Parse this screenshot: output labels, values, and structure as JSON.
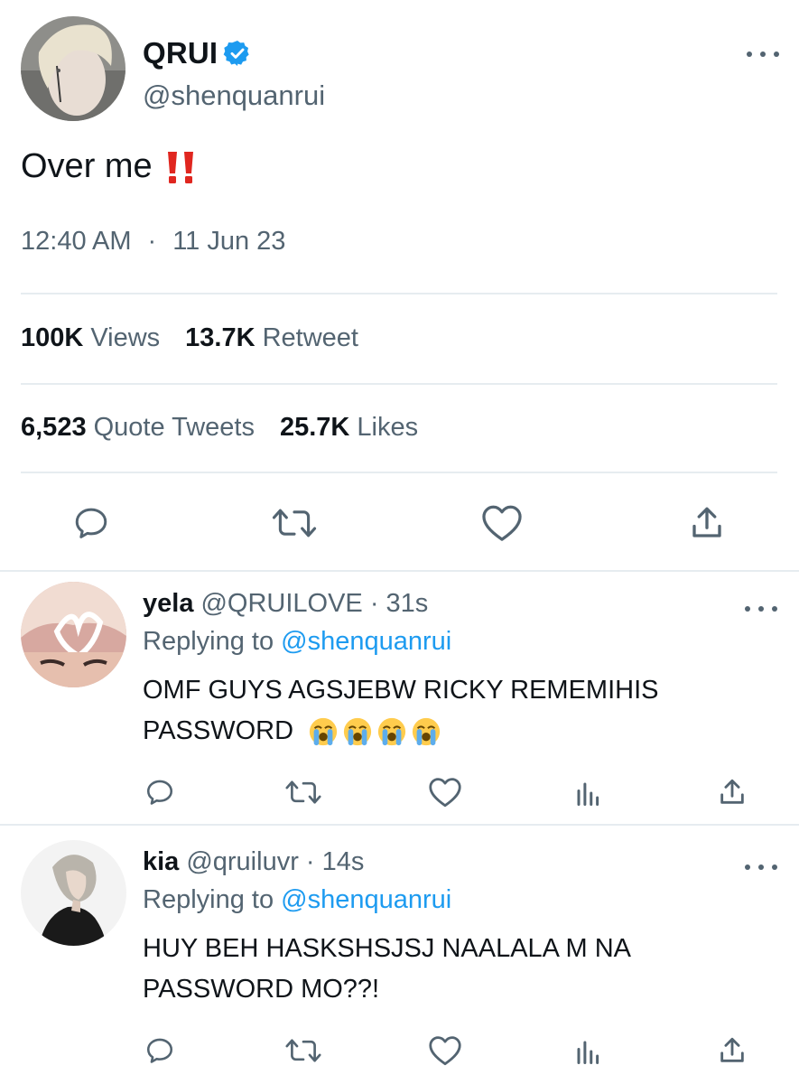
{
  "main_tweet": {
    "display_name": "QRUI",
    "handle": "@shenquanrui",
    "text": "Over me",
    "emoji": "double-exclamation",
    "time": "12:40 AM",
    "separator": "·",
    "date": "11 Jun 23",
    "stats": {
      "views_count": "100K",
      "views_label": "Views",
      "retweets_count": "13.7K",
      "retweets_label": "Retweet",
      "quotes_count": "6,523",
      "quotes_label": "Quote Tweets",
      "likes_count": "25.7K",
      "likes_label": "Likes"
    },
    "actions": [
      "reply-icon",
      "retweet-icon",
      "like-icon",
      "share-icon"
    ]
  },
  "replies": [
    {
      "display_name": "yela",
      "handle_time": "@QRUILOVE · 31s",
      "replying_prefix": "Replying to",
      "replying_to": "@shenquanrui",
      "text": "OMF GUYS AGSJEBW RICKY REMEMIHIS PASSWORD",
      "emojis": [
        "loudly-crying-face",
        "loudly-crying-face",
        "loudly-crying-face",
        "loudly-crying-face"
      ],
      "actions": [
        "reply-icon",
        "retweet-icon",
        "like-icon",
        "analytics-icon",
        "share-icon"
      ]
    },
    {
      "display_name": "kia",
      "handle_time": "@qruiluvr · 14s",
      "replying_prefix": "Replying to",
      "replying_to": "@shenquanrui",
      "text": "HUY BEH HASKSHSJSJ NAALALA M NA PASSWORD MO??!",
      "actions": [
        "reply-icon",
        "retweet-icon",
        "like-icon",
        "analytics-icon",
        "share-icon"
      ]
    }
  ],
  "colors": {
    "text": "#0f1419",
    "secondary": "#536471",
    "link": "#1d9bf0",
    "divider": "#e6ecf0",
    "verified": "#1d9bf0",
    "exclamation": "#e0261f"
  }
}
